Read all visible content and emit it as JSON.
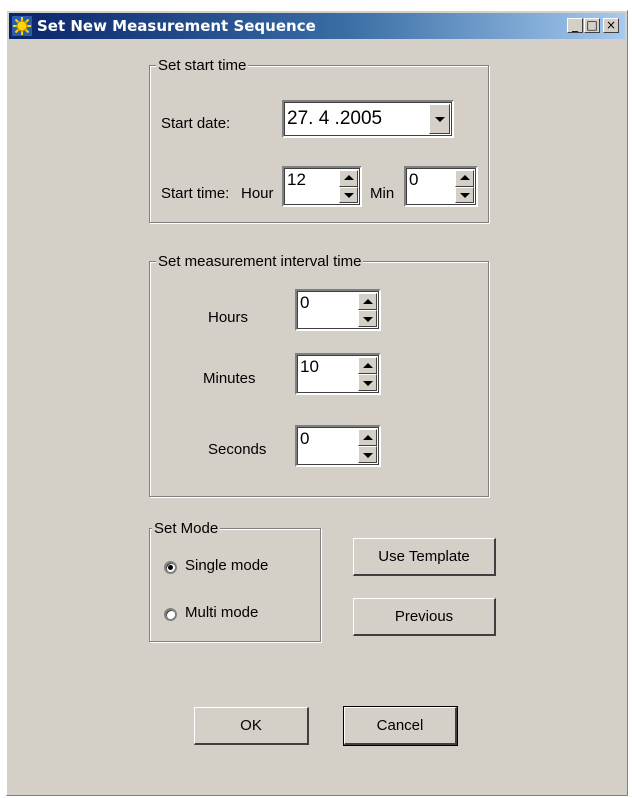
{
  "window": {
    "title": "Set New Measurement Sequence",
    "controls": {
      "minimize": "_",
      "maximize": "□",
      "close": "×"
    }
  },
  "start_group": {
    "legend": "Set start time",
    "start_date_label": "Start date:",
    "start_date_value": "27. 4 .2005",
    "start_time_label": "Start time:",
    "hour_label": "Hour",
    "hour_value": "12",
    "min_label": "Min",
    "min_value": "0"
  },
  "interval_group": {
    "legend": "Set measurement interval time",
    "hours_label": "Hours",
    "hours_value": "0",
    "minutes_label": "Minutes",
    "minutes_value": "10",
    "seconds_label": "Seconds",
    "seconds_value": "0"
  },
  "mode_group": {
    "legend": "Set Mode",
    "options": [
      {
        "label": "Single mode",
        "selected": true
      },
      {
        "label": "Multi mode",
        "selected": false
      }
    ]
  },
  "buttons": {
    "use_template": "Use Template",
    "previous": "Previous",
    "ok": "OK",
    "cancel": "Cancel"
  },
  "colors": {
    "face": "#d4d0c8",
    "title_start": "#0a246a",
    "title_end": "#a6caf0"
  },
  "icons": [
    "sun-app-icon",
    "minimize-icon",
    "maximize-icon",
    "close-icon",
    "dropdown-arrow-icon",
    "spin-up-icon",
    "spin-down-icon"
  ]
}
